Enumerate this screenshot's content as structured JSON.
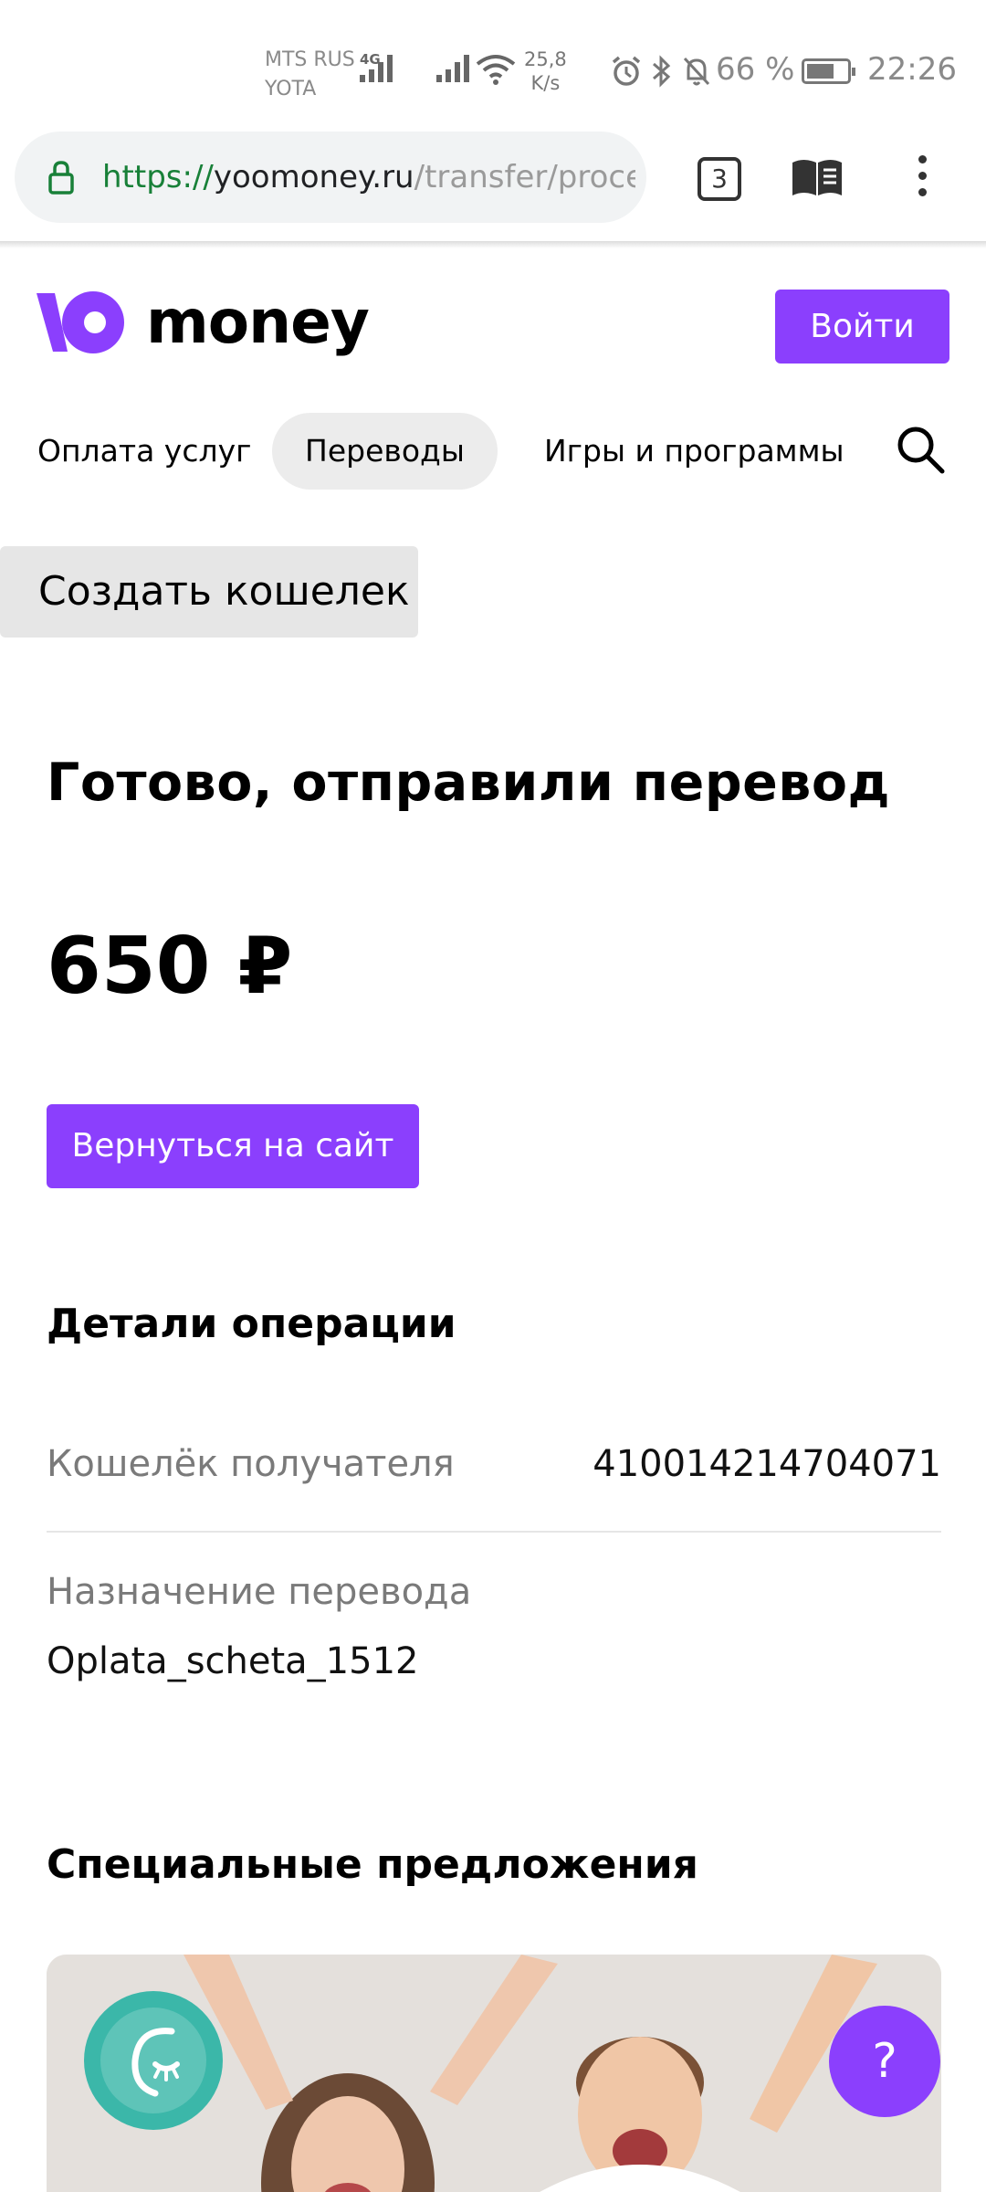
{
  "status_bar": {
    "carrier_1": "MTS RUS",
    "carrier_2": "YOTA",
    "network_type": "4G",
    "speed_value": "25,8",
    "speed_unit": "K/s",
    "battery_percent": "66 %",
    "time": "22:26",
    "icons": [
      "signal-icon",
      "wifi-icon",
      "alarm-icon",
      "bluetooth-icon",
      "bell-off-icon",
      "battery-icon"
    ]
  },
  "browser": {
    "url_scheme": "https://",
    "url_host": "yoomoney.ru",
    "url_path": "/transfer/process/",
    "tab_count": "3"
  },
  "header": {
    "logo_text": "money",
    "login_label": "Войти",
    "brand_color": "#8b3ffd"
  },
  "nav": {
    "items": [
      {
        "label": "Оплата услуг",
        "active": false
      },
      {
        "label": "Переводы",
        "active": true
      },
      {
        "label": "Игры и программы",
        "active": false
      }
    ]
  },
  "create_wallet_label": "Создать кошелек",
  "main": {
    "title": "Готово, отправили перевод",
    "amount": "650 ₽",
    "back_button_label": "Вернуться на сайт"
  },
  "details": {
    "title": "Детали операции",
    "rows": [
      {
        "label": "Кошелёк получателя",
        "value": "410014214704071"
      },
      {
        "label": "Назначение перевода",
        "value": "Oplata_scheta_1512"
      }
    ]
  },
  "offers": {
    "title": "Специальные предложения"
  },
  "help_label": "?"
}
